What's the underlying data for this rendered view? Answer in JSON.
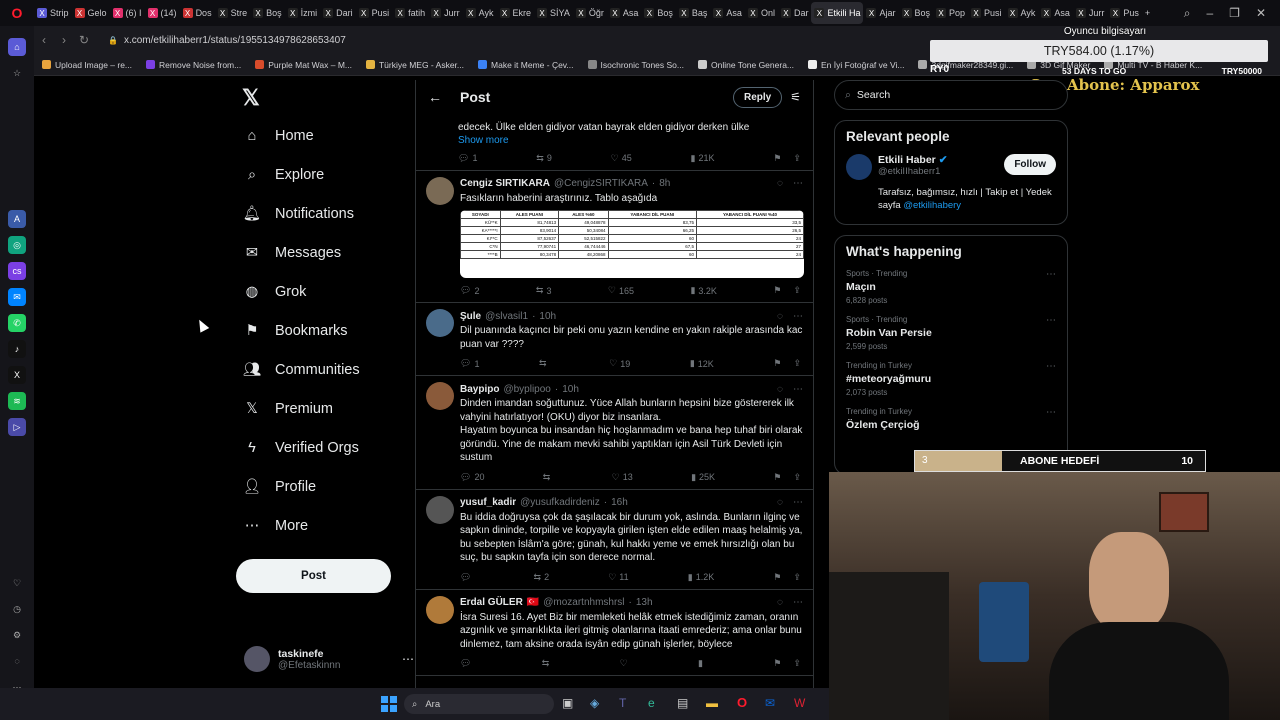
{
  "browser": {
    "tabs": [
      {
        "label": "Strip",
        "color": "#5b5bd6"
      },
      {
        "label": "Gelo",
        "color": "#c33"
      },
      {
        "label": "(6) I",
        "color": "#e1306c"
      },
      {
        "label": "(14)",
        "color": "#e1306c"
      },
      {
        "label": "Dos",
        "color": "#c33"
      },
      {
        "label": "Stre",
        "color": "#222"
      },
      {
        "label": "Boş",
        "color": "#222"
      },
      {
        "label": "İzmi",
        "color": "#222"
      },
      {
        "label": "Dari",
        "color": "#222"
      },
      {
        "label": "Pusi",
        "color": "#222"
      },
      {
        "label": "fatih",
        "color": "#222"
      },
      {
        "label": "Jurr",
        "color": "#222"
      },
      {
        "label": "Ayk",
        "color": "#222"
      },
      {
        "label": "Ekre",
        "color": "#222"
      },
      {
        "label": "SİYA",
        "color": "#222"
      },
      {
        "label": "Öğr",
        "color": "#222"
      },
      {
        "label": "Asa",
        "color": "#222"
      },
      {
        "label": "Boş",
        "color": "#222"
      },
      {
        "label": "Baş",
        "color": "#222"
      },
      {
        "label": "Asa",
        "color": "#222"
      },
      {
        "label": "Onl",
        "color": "#222"
      },
      {
        "label": "Dar",
        "color": "#222"
      },
      {
        "label": "Etkili Ha",
        "color": "#222",
        "active": true
      },
      {
        "label": "Ajar",
        "color": "#222"
      },
      {
        "label": "Boş",
        "color": "#222"
      },
      {
        "label": "Pop",
        "color": "#222"
      },
      {
        "label": "Pusi",
        "color": "#222"
      },
      {
        "label": "Ayk",
        "color": "#222"
      },
      {
        "label": "Asa",
        "color": "#222"
      },
      {
        "label": "Jurr",
        "color": "#222"
      },
      {
        "label": "Pus",
        "color": "#222"
      }
    ],
    "url": "x.com/etkilihaberr1/status/1955134978628653407",
    "bookmarks": [
      {
        "label": "Upload Image – re...",
        "color": "#e8a33d"
      },
      {
        "label": "Remove Noise from...",
        "color": "#7b3fe4"
      },
      {
        "label": "Purple Mat Wax – M...",
        "color": "#d84c2b"
      },
      {
        "label": "Türkiye MEG - Asker...",
        "color": "#e3b341"
      },
      {
        "label": "Make it Meme - Çev...",
        "color": "#3b82f6"
      },
      {
        "label": "Isochronic Tones So...",
        "color": "#888"
      },
      {
        "label": "Online Tone Genera...",
        "color": "#ccc"
      },
      {
        "label": "En İyi Fotoğraf ve Vi...",
        "color": "#eee"
      },
      {
        "label": "3dgifmaker28349.gi...",
        "color": "#aaa"
      },
      {
        "label": "3D Gif Maker",
        "color": "#aaa"
      },
      {
        "label": "Multi TV - B Haber K...",
        "color": "#aaa"
      }
    ]
  },
  "stream": {
    "title": "Oyuncu bilgisayarı",
    "price": "TRY584.00 (1.17%)",
    "left_label": "RY0",
    "days": "53 DAYS TO GO",
    "right_label": "TRY50000",
    "last_sub": "Son Abone: Apparox",
    "goal_label": "ABONE HEDEFİ",
    "goal_current": "3",
    "goal_target": "10",
    "goal_progress": 0.3
  },
  "nav": {
    "items": [
      {
        "label": "Home",
        "icon": "home-icon"
      },
      {
        "label": "Explore",
        "icon": "search-icon"
      },
      {
        "label": "Notifications",
        "icon": "bell-icon"
      },
      {
        "label": "Messages",
        "icon": "mail-icon"
      },
      {
        "label": "Grok",
        "icon": "grok-icon"
      },
      {
        "label": "Bookmarks",
        "icon": "bookmark-icon"
      },
      {
        "label": "Communities",
        "icon": "communities-icon"
      },
      {
        "label": "Premium",
        "icon": "x-premium-icon"
      },
      {
        "label": "Verified Orgs",
        "icon": "lightning-icon"
      },
      {
        "label": "Profile",
        "icon": "person-icon"
      },
      {
        "label": "More",
        "icon": "more-icon"
      }
    ],
    "post_button": "Post",
    "account": {
      "name": "taskinefe",
      "handle": "@Efetaskinnn"
    }
  },
  "post_header": {
    "title": "Post",
    "reply_button": "Reply"
  },
  "tweets": [
    {
      "partial": true,
      "text": "edecek. Ülke elden gidiyor vatan bayrak elden gidiyor derken ülke",
      "show_more": "Show more",
      "stats": {
        "replies": "1",
        "reposts": "9",
        "likes": "45",
        "views": "21K"
      }
    },
    {
      "name": "Cengiz SIRTIKARA",
      "handle": "@CengizSIRTIKARA",
      "time": "8h",
      "text": "Fasıkların haberini araştırınız. Tablo aşağıda",
      "avatar": "#7a6a55",
      "stats": {
        "replies": "2",
        "reposts": "3",
        "likes": "165",
        "views": "3.2K"
      },
      "table": {
        "headers": [
          "SOYADI",
          "ALES PUANI",
          "ALES %60",
          "YABANCI DİL PUANI",
          "YABANCI DİL PUANI %40"
        ],
        "rows": [
          [
            "KÜ**K",
            "81,74813",
            "49,048878",
            "83,75",
            "33,5"
          ],
          [
            "KA*****I",
            "83,9014",
            "50,34084",
            "66,25",
            "26,5"
          ],
          [
            "KI**C",
            "87,52637",
            "52,515822",
            "60",
            "24"
          ],
          [
            "C*N",
            "77,90741",
            "46,744446",
            "67,5",
            "27"
          ],
          [
            "****B",
            "80,3478",
            "48,20868",
            "60",
            "24"
          ]
        ]
      }
    },
    {
      "name": "Şule",
      "handle": "@slvasil1",
      "time": "10h",
      "text": "Dil puanında kaçıncı bir peki onu yazın kendine en yakın rakiple arasında kac puan var ????",
      "avatar": "#4a6b8a",
      "stats": {
        "replies": "1",
        "reposts": "",
        "likes": "19",
        "views": "12K"
      }
    },
    {
      "name": "Baypipo",
      "handle": "@byplipoo",
      "time": "10h",
      "text": "Dinden imandan soğuttunuz. Yüce Allah bunların hepsini bize göstererek ilk vahyini hatırlatıyor! (OKU) diyor biz insanlara.\nHayatım boyunca bu insandan hiç hoşlanmadım ve bana hep tuhaf biri olarak göründü. Yine de makam mevki sahibi yaptıkları için Asil Türk Devleti için sustum",
      "avatar": "#8a5a3a",
      "stats": {
        "replies": "20",
        "reposts": "",
        "likes": "13",
        "views": "25K"
      }
    },
    {
      "name": "yusuf_kadir",
      "handle": "@yusufkadirdeniz",
      "time": "16h",
      "text": "Bu iddia doğruysa çok da şaşılacak bir durum yok, aslında. Bunların ilginç ve sapkın dininde, torpille ve kopyayla girilen işten elde edilen maaş helalmiş ya, bu sebepten İslâm'a göre; günah, kul hakkı yeme ve emek hırsızlığı olan bu suç, bu sapkın tayfa için son derece normal.",
      "avatar": "#555",
      "stats": {
        "replies": "",
        "reposts": "2",
        "likes": "11",
        "views": "1.2K"
      }
    },
    {
      "name": "Erdal GÜLER",
      "flag": "🇹🇷",
      "handle": "@mozartnhmshrsl",
      "time": "13h",
      "text": "İsra Suresi 16. Ayet Biz bir memleketi helâk etmek istediğimiz zaman, oranın azgınlık ve şımarıklıkta ileri gitmiş olanlarına itaati emrederiz; ama onlar bunu dinlemez, tam aksine orada isyân edip günah işlerler, böylece",
      "avatar": "#b07a3a",
      "stats": {
        "replies": "",
        "reposts": "",
        "likes": "",
        "views": ""
      }
    }
  ],
  "right": {
    "search_placeholder": "Search",
    "relevant_title": "Relevant people",
    "person": {
      "name": "Etkili Haber",
      "handle": "@etkiIIhaberr1",
      "bio": "Tarafsız, bağımsız, hızlı | Takip et | Yedek sayfa ",
      "bio_link": "@etkilihabery",
      "follow": "Follow"
    },
    "happening_title": "What's happening",
    "trends": [
      {
        "context": "Sports · Trending",
        "name": "Maçın",
        "count": "6,828 posts"
      },
      {
        "context": "Sports · Trending",
        "name": "Robin Van Persie",
        "count": "2,599 posts"
      },
      {
        "context": "Trending in Turkey",
        "name": "#meteoryağmuru",
        "count": "2,073 posts"
      },
      {
        "context": "Trending in Turkey",
        "name": "Özlem Çerçioğ",
        "count": ""
      }
    ]
  },
  "taskbar": {
    "search": "Ara"
  }
}
